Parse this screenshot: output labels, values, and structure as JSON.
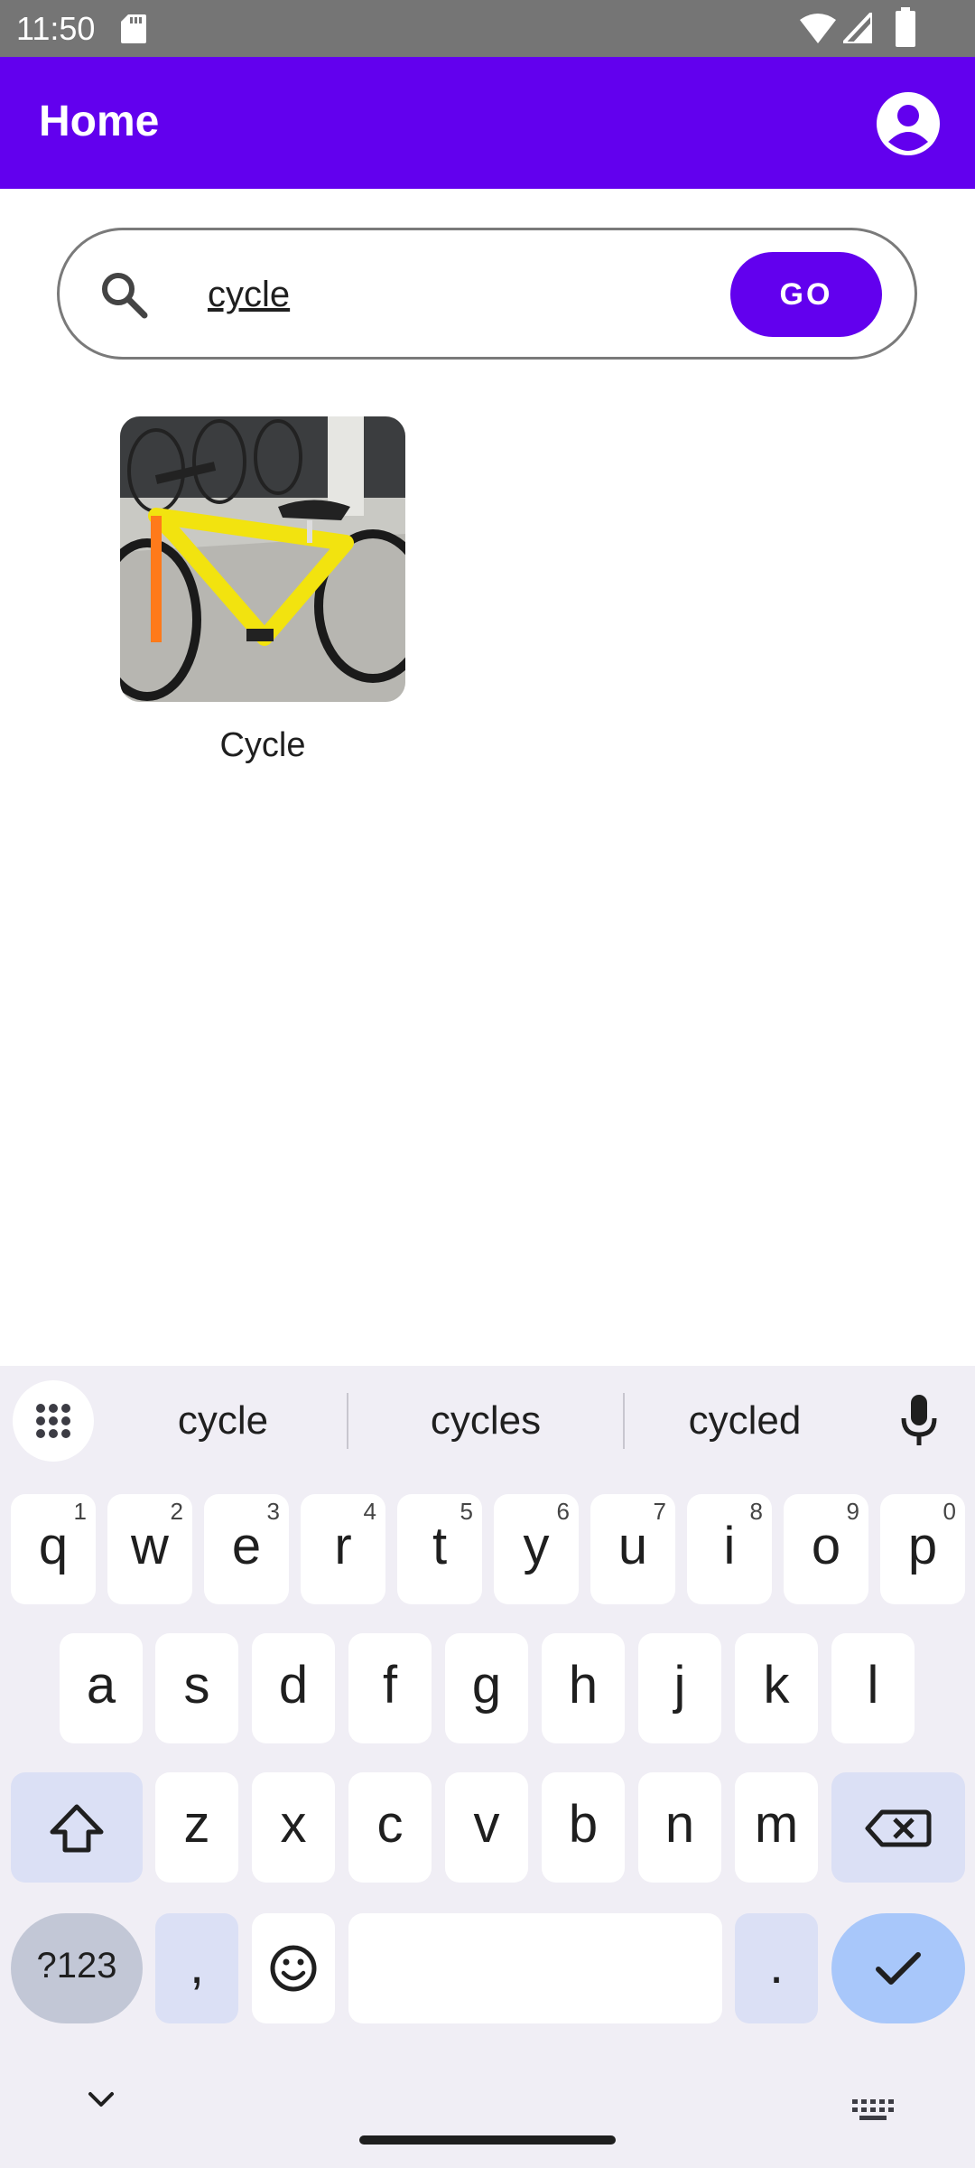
{
  "status_bar": {
    "time": "11:50",
    "icons": [
      "sd-card-icon",
      "wifi-icon",
      "signal-icon",
      "battery-icon"
    ]
  },
  "app_bar": {
    "title": "Home",
    "account_icon": "account-circle-icon",
    "color": "#6200ee"
  },
  "search": {
    "icon": "search-icon",
    "value": "cycle",
    "go_label": "GO"
  },
  "results": [
    {
      "label": "Cycle",
      "image": "yellow bicycle photo"
    }
  ],
  "keyboard": {
    "suggestions": [
      "cycle",
      "cycles",
      "cycled"
    ],
    "row1": [
      {
        "key": "q",
        "hint": "1"
      },
      {
        "key": "w",
        "hint": "2"
      },
      {
        "key": "e",
        "hint": "3"
      },
      {
        "key": "r",
        "hint": "4"
      },
      {
        "key": "t",
        "hint": "5"
      },
      {
        "key": "y",
        "hint": "6"
      },
      {
        "key": "u",
        "hint": "7"
      },
      {
        "key": "i",
        "hint": "8"
      },
      {
        "key": "o",
        "hint": "9"
      },
      {
        "key": "p",
        "hint": "0"
      }
    ],
    "row2": [
      "a",
      "s",
      "d",
      "f",
      "g",
      "h",
      "j",
      "k",
      "l"
    ],
    "row3": [
      "z",
      "x",
      "c",
      "v",
      "b",
      "n",
      "m"
    ],
    "symbols_label": "?123",
    "comma_label": ",",
    "period_label": ".",
    "shift_icon": "shift-icon",
    "backspace_icon": "backspace-icon",
    "emoji_icon": "emoji-icon",
    "enter_icon": "check-icon",
    "apps_icon": "apps-grid-icon",
    "mic_icon": "microphone-icon"
  },
  "nav": {
    "hide_keyboard_icon": "chevron-down-icon",
    "switch_keyboard_icon": "keyboard-icon"
  }
}
